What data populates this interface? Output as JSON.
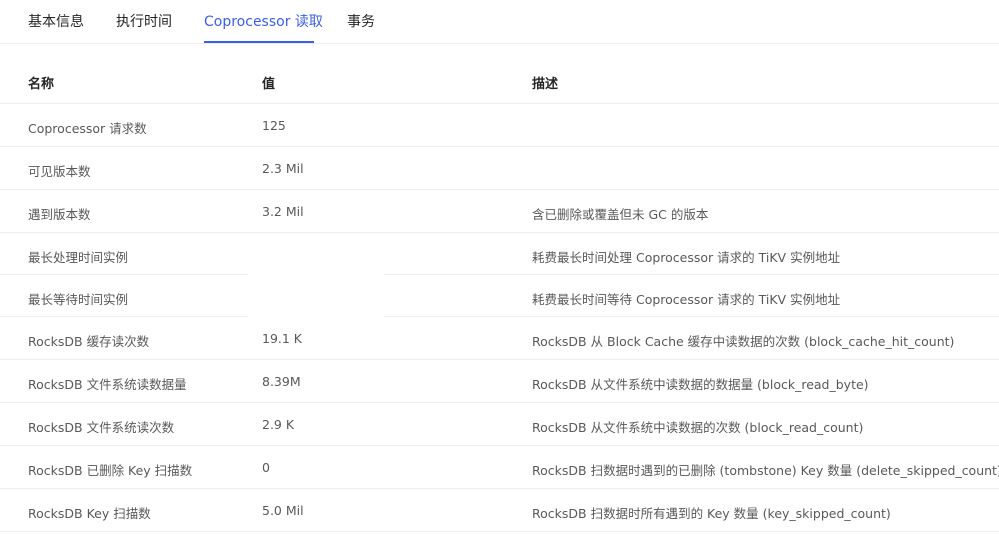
{
  "tabs": [
    {
      "label": "基本信息"
    },
    {
      "label": "执行时间"
    },
    {
      "label": "Coprocessor 读取",
      "active": true
    },
    {
      "label": "事务"
    }
  ],
  "table": {
    "headers": [
      "名称",
      "值",
      "描述"
    ],
    "rows": [
      {
        "name": "Coprocessor 请求数",
        "value": "125",
        "desc": ""
      },
      {
        "name": "可见版本数",
        "value": "2.3 Mil",
        "desc": ""
      },
      {
        "name": "遇到版本数",
        "value": "3.2 Mil",
        "desc": "含已删除或覆盖但未 GC 的版本"
      },
      {
        "name": "最长处理时间实例",
        "value": "",
        "desc": "耗费最长时间处理 Coprocessor 请求的 TiKV 实例地址"
      },
      {
        "name": "最长等待时间实例",
        "value": "",
        "desc": "耗费最长时间等待 Coprocessor 请求的 TiKV 实例地址"
      },
      {
        "name": "RocksDB 缓存读次数",
        "value": "19.1 K",
        "desc": "RocksDB 从 Block Cache 缓存中读数据的次数 (block_cache_hit_count)"
      },
      {
        "name": "RocksDB 文件系统读数据量",
        "value": "8.39M",
        "desc": "RocksDB 从文件系统中读数据的数据量 (block_read_byte)"
      },
      {
        "name": "RocksDB 文件系统读次数",
        "value": "2.9 K",
        "desc": "RocksDB 从文件系统中读数据的次数 (block_read_count)"
      },
      {
        "name": "RocksDB 已删除 Key 扫描数",
        "value": "0",
        "desc": "RocksDB 扫数据时遇到的已删除 (tombstone) Key 数量 (delete_skipped_count)"
      },
      {
        "name": "RocksDB Key 扫描数",
        "value": "5.0 Mil",
        "desc": "RocksDB 扫数据时所有遇到的 Key 数量 (key_skipped_count)"
      }
    ]
  },
  "colors": {
    "accent": "#3c5fe8",
    "border": "#eeeeee",
    "text": "#595959"
  }
}
